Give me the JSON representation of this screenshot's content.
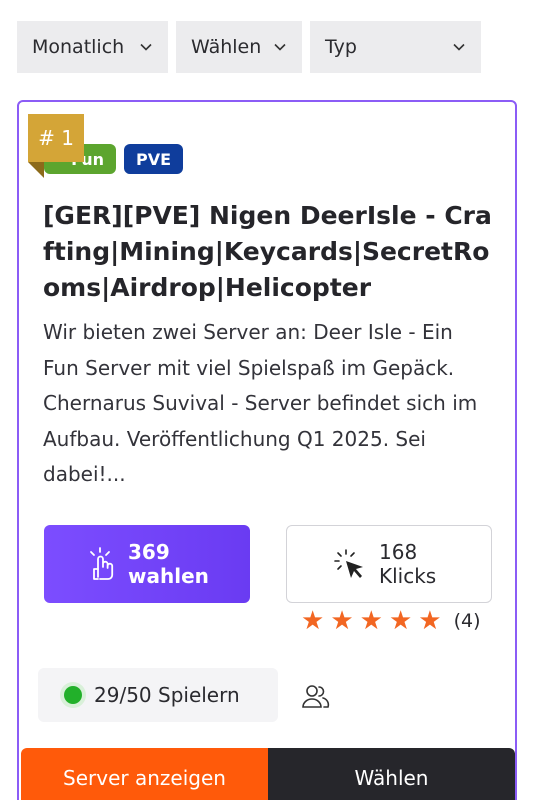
{
  "filters": [
    {
      "label": "Monatlich"
    },
    {
      "label": "Wählen"
    },
    {
      "label": "Typ"
    }
  ],
  "server": {
    "rank": "# 1",
    "tags": [
      {
        "label": "Fun",
        "color": "#5ca52e"
      },
      {
        "label": "PVE",
        "color": "#0f3d9c"
      }
    ],
    "title": "[GER][PVE] Nigen DeerIsle - Crafting|Mining|Keycards|SecretRooms|Airdrop|Helicopter",
    "description": "Wir bieten zwei Server an: Deer Isle - Ein Fun Server mit viel Spielspaß im Gepäck. Chernarus Suvival - Server befindet sich im Aufbau. Veröffentlichung Q1 2025. Sei dabei!...",
    "votes": {
      "count": "369",
      "label": "wahlen"
    },
    "clicks": {
      "count": "168",
      "label": "Klicks"
    },
    "rating": {
      "stars": 5,
      "count_label": "(4)"
    },
    "players": "29/50 Spielern",
    "buttons": {
      "show": "Server anzeigen",
      "vote": "Wählen"
    }
  },
  "colors": {
    "accent": "#8b5cf6",
    "vote_button": "#7c4dff",
    "show_button": "#ff5a0a",
    "vote_button_dark": "#26262b",
    "star": "#f26622",
    "online": "#22b02a",
    "rank_badge": "#d4a537"
  }
}
